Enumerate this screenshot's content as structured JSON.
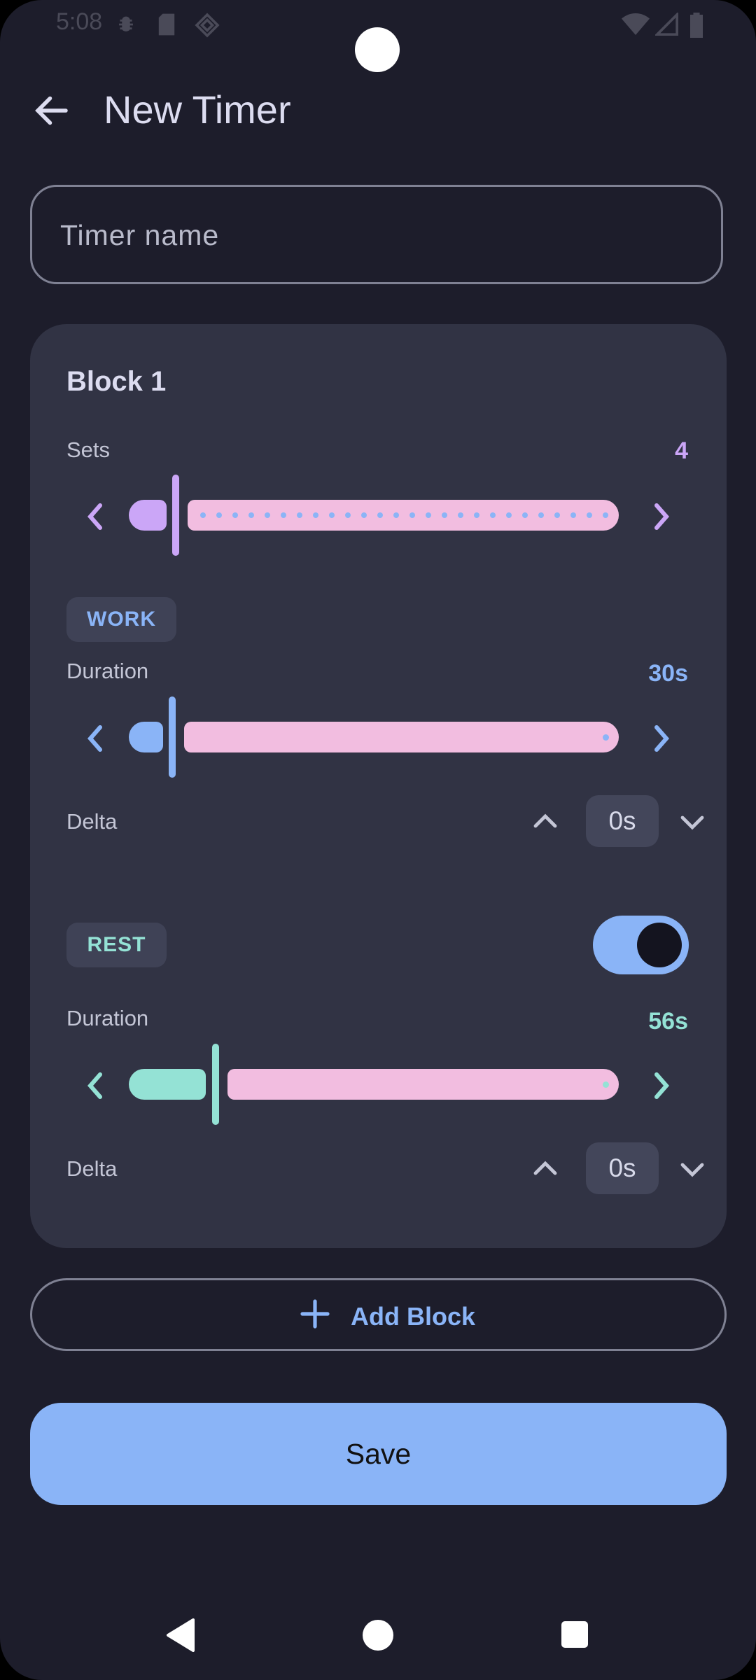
{
  "status_bar": {
    "time": "5:08"
  },
  "app_bar": {
    "title": "New Timer"
  },
  "name_field": {
    "placeholder": "Timer name"
  },
  "block": {
    "title": "Block 1",
    "sets": {
      "label": "Sets",
      "value": "4",
      "level": 0.08,
      "color": "#cba6f7"
    },
    "work": {
      "chip": "WORK",
      "duration_label": "Duration",
      "duration_value": "30s",
      "level": 0.06,
      "color": "#8ab4f7",
      "delta_label": "Delta",
      "delta_value": "0s"
    },
    "rest": {
      "chip": "REST",
      "enabled": true,
      "duration_label": "Duration",
      "duration_value": "56s",
      "level": 0.14,
      "color": "#94e2d5",
      "delta_label": "Delta",
      "delta_value": "0s"
    }
  },
  "add_block": {
    "label": "Add Block"
  },
  "save": {
    "label": "Save"
  },
  "colors": {
    "accent": "#8ab4f7",
    "track": "#f2bde0",
    "background": "#1d1d2b",
    "card": "#313344"
  }
}
